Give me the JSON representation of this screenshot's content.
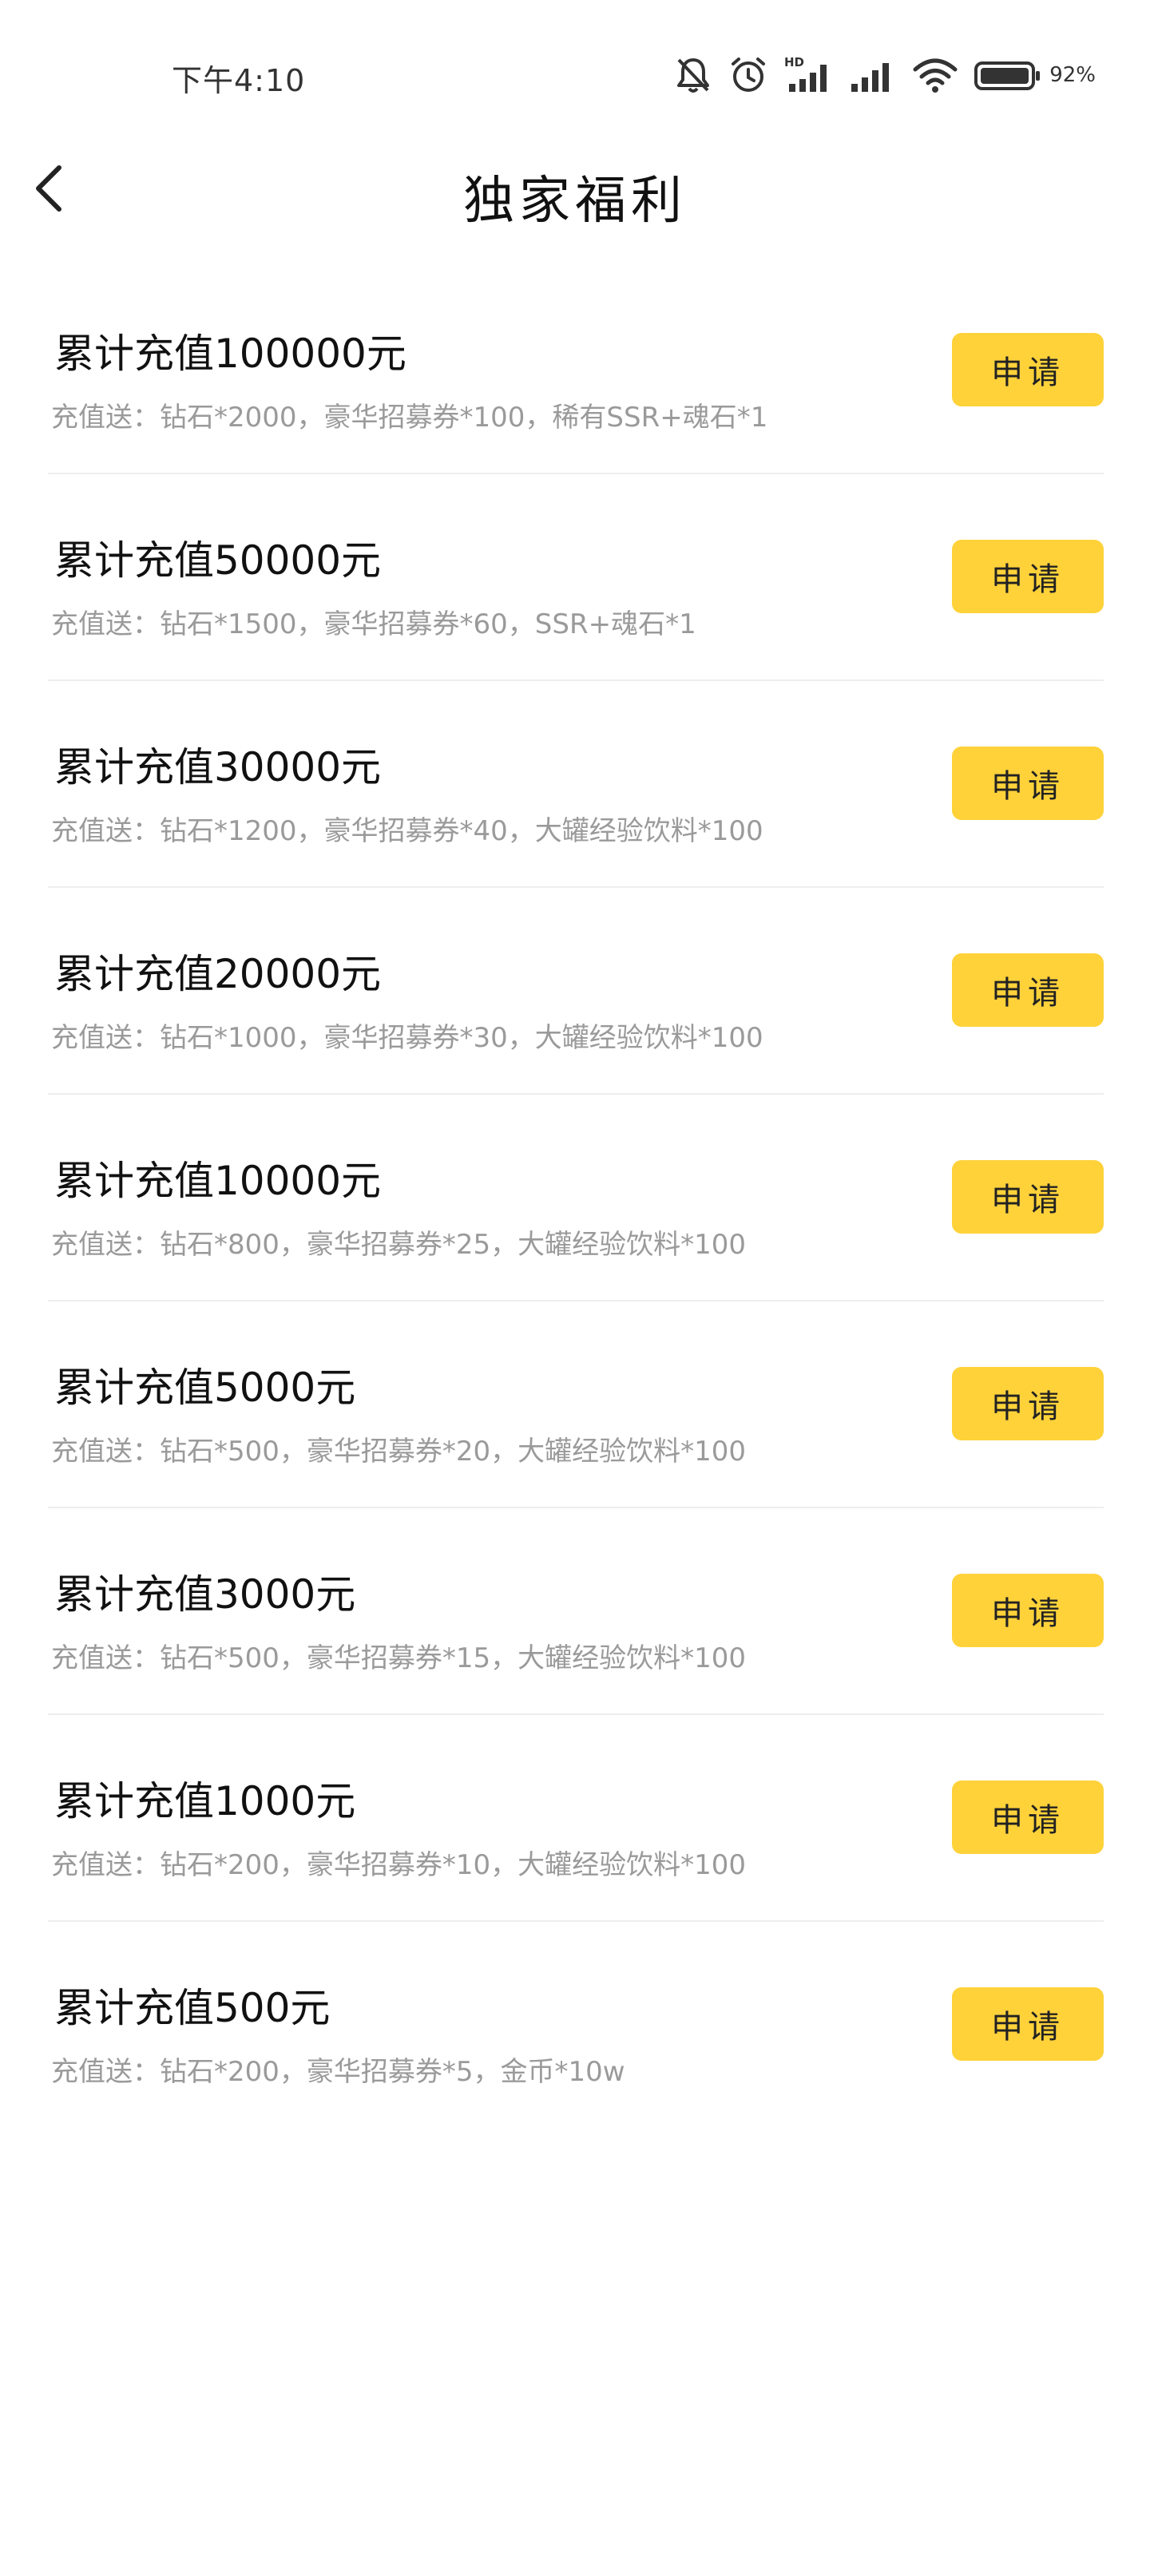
{
  "status_bar": {
    "time": "下午4:10",
    "battery_percent": "92%",
    "network_label": "HD",
    "icons": [
      "mute-icon",
      "alarm-icon",
      "signal-hd-icon",
      "signal-icon",
      "wifi-icon",
      "battery-icon"
    ]
  },
  "header": {
    "title": "独家福利",
    "back_icon": "chevron-left-icon"
  },
  "colors": {
    "accent": "#ffd23a",
    "title_text": "#111111",
    "desc_text": "#9a9a9a",
    "divider": "#eeeeee"
  },
  "benefits": [
    {
      "title": "累计充值100000元",
      "desc": "充值送：钻石*2000，豪华招募券*100，稀有SSR+魂石*1",
      "button": "申请"
    },
    {
      "title": "累计充值50000元",
      "desc": "充值送：钻石*1500，豪华招募券*60，SSR+魂石*1",
      "button": "申请"
    },
    {
      "title": "累计充值30000元",
      "desc": "充值送：钻石*1200，豪华招募券*40，大罐经验饮料*100",
      "button": "申请"
    },
    {
      "title": "累计充值20000元",
      "desc": "充值送：钻石*1000，豪华招募券*30，大罐经验饮料*100",
      "button": "申请"
    },
    {
      "title": "累计充值10000元",
      "desc": "充值送：钻石*800，豪华招募券*25，大罐经验饮料*100",
      "button": "申请"
    },
    {
      "title": "累计充值5000元",
      "desc": "充值送：钻石*500，豪华招募券*20，大罐经验饮料*100",
      "button": "申请"
    },
    {
      "title": "累计充值3000元",
      "desc": "充值送：钻石*500，豪华招募券*15，大罐经验饮料*100",
      "button": "申请"
    },
    {
      "title": "累计充值1000元",
      "desc": "充值送：钻石*200，豪华招募券*10，大罐经验饮料*100",
      "button": "申请"
    },
    {
      "title": "累计充值500元",
      "desc": "充值送：钻石*200，豪华招募券*5，金币*10w",
      "button": "申请"
    }
  ]
}
